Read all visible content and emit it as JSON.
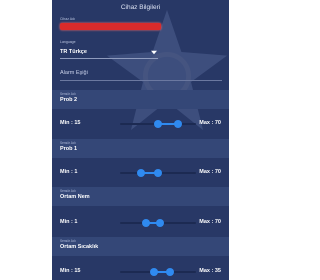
{
  "header": {
    "title": "Cihaz Bilgileri"
  },
  "device_name": {
    "label": "Cihaz Adı",
    "value": ""
  },
  "language": {
    "label": "Language",
    "value": "TR Türkçe"
  },
  "alarm_section": {
    "title": "Alarm Eşiği"
  },
  "sensors": [
    {
      "small_label": "Sensör Adı",
      "name": "Prob 2",
      "min_label": "Min : 15",
      "max_label": "Max : 70",
      "min": 15,
      "max": 70,
      "low": 0.5,
      "high": 0.76
    },
    {
      "small_label": "Sensör Adı",
      "name": "Prob 1",
      "min_label": "Min : 1",
      "max_label": "Max : 70",
      "min": 1,
      "max": 70,
      "low": 0.28,
      "high": 0.5
    },
    {
      "small_label": "Sensör Adı",
      "name": "Ortam Nem",
      "min_label": "Min : 1",
      "max_label": "Max : 70",
      "min": 1,
      "max": 70,
      "low": 0.34,
      "high": 0.52
    },
    {
      "small_label": "Sensör Adı",
      "name": "Ortam Sıcaklık",
      "min_label": "Min : 15",
      "max_label": "Max : 35",
      "min": 15,
      "max": 35,
      "low": 0.45,
      "high": 0.66
    }
  ],
  "colors": {
    "background": "#283866",
    "accent": "#2f8af0",
    "name_field": "#d92b2b"
  }
}
